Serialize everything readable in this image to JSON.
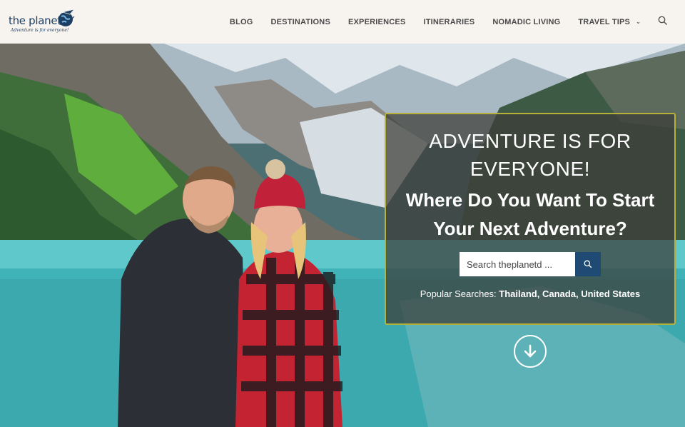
{
  "header": {
    "logo": {
      "name": "the planet",
      "tagline": "Adventure is for everyone!"
    },
    "nav": [
      {
        "label": "BLOG",
        "has_dropdown": false
      },
      {
        "label": "DESTINATIONS",
        "has_dropdown": false
      },
      {
        "label": "EXPERIENCES",
        "has_dropdown": false
      },
      {
        "label": "ITINERARIES",
        "has_dropdown": false
      },
      {
        "label": "NOMADIC LIVING",
        "has_dropdown": false
      },
      {
        "label": "TRAVEL TIPS",
        "has_dropdown": true
      }
    ],
    "search_icon": "search-icon"
  },
  "hero": {
    "title_line1": "ADVENTURE IS FOR",
    "title_line2": "EVERYONE!",
    "subtitle_line1": "Where Do You Want To Start",
    "subtitle_line2": "Your Next Adventure?",
    "search": {
      "placeholder": "Search theplanetd ..."
    },
    "popular_label": "Popular Searches:",
    "popular_links": [
      "Thailand",
      "Canada",
      "United States"
    ],
    "scroll_icon": "arrow-down-circle-icon"
  },
  "colors": {
    "header_bg": "#f7f3ef",
    "nav_text": "#4a4a4a",
    "overlay_border": "#b7b13a",
    "search_button": "#1e4a73",
    "brand": "#1d3f63"
  }
}
